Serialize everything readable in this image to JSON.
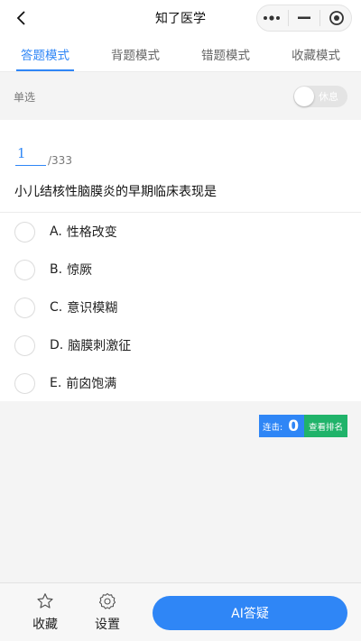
{
  "navbar": {
    "title": "知了医学",
    "back_icon": "chevron-left-icon",
    "more_icon": "more-dots-icon",
    "minimize_icon": "minus-icon",
    "close_icon": "target-circle-icon"
  },
  "tabs": [
    {
      "label": "答题模式",
      "active": true
    },
    {
      "label": "背题模式",
      "active": false
    },
    {
      "label": "错题模式",
      "active": false
    },
    {
      "label": "收藏模式",
      "active": false
    }
  ],
  "question_type": "单选",
  "rest_toggle": {
    "label": "休息",
    "on": false
  },
  "question": {
    "current": "1",
    "total": "/333",
    "text": "小儿结核性脑膜炎的早期临床表现是",
    "options": [
      {
        "key": "A.",
        "text": "性格改变"
      },
      {
        "key": "B.",
        "text": "惊厥"
      },
      {
        "key": "C.",
        "text": "意识模糊"
      },
      {
        "key": "D.",
        "text": "脑膜刺激征"
      },
      {
        "key": "E.",
        "text": "前囟饱满"
      }
    ]
  },
  "streak": {
    "label": "连击:",
    "count": "0",
    "ranking_label": "查看排名"
  },
  "bottom_bar": {
    "favorite_label": "收藏",
    "settings_label": "设置",
    "ai_label": "AI答疑"
  },
  "colors": {
    "accent": "#2f86f6",
    "ranking_green": "#20b36a"
  }
}
